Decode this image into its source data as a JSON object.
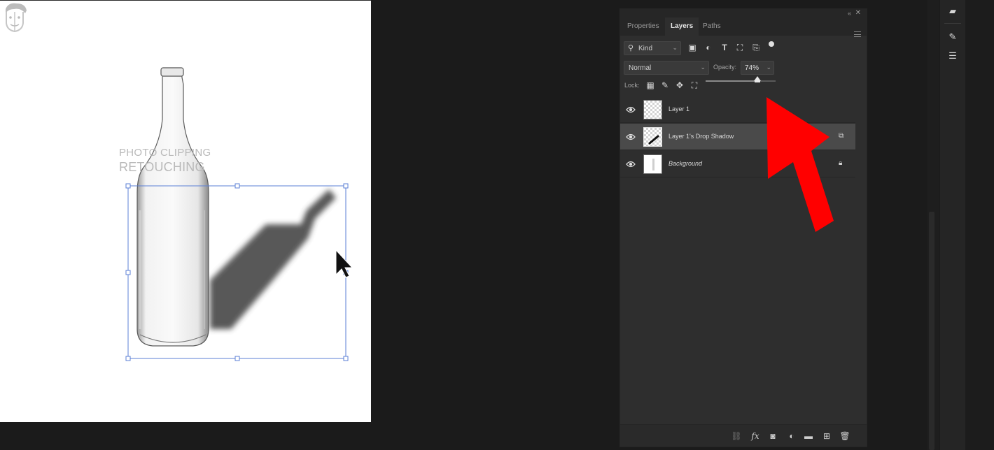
{
  "canvas": {
    "watermark": {
      "line1": "PHOTO CLIPPING",
      "line2": "RETOUCHING"
    }
  },
  "panel": {
    "tabs": [
      {
        "label": "Properties",
        "active": false
      },
      {
        "label": "Layers",
        "active": true
      },
      {
        "label": "Paths",
        "active": false
      }
    ],
    "filter": {
      "kind_label": "Kind"
    },
    "blend_mode": "Normal",
    "opacity": {
      "label": "Opacity:",
      "value": "74%",
      "level": 0.74
    },
    "lock_label": "Lock:",
    "layers": [
      {
        "name": "Layer 1",
        "selected": false,
        "visible": true,
        "italic": false,
        "badge": ""
      },
      {
        "name": "Layer 1's Drop Shadow",
        "selected": true,
        "visible": true,
        "italic": false,
        "badge": "linked-layer-icon"
      },
      {
        "name": "Background",
        "selected": false,
        "visible": true,
        "italic": true,
        "badge": "lock-icon"
      }
    ],
    "bottom_icons": [
      "link-layers-icon",
      "fx-icon",
      "add-mask-icon",
      "adjustment-layer-icon",
      "group-folder-icon",
      "new-layer-icon",
      "delete-layer-icon"
    ]
  },
  "right_toolbar": {
    "icons": [
      "comment-icon",
      "brush-settings-icon",
      "adjustments-sliders-icon"
    ]
  },
  "colors": {
    "arrow": "#ff0000",
    "selection": "#4a6fd8",
    "panel_bg": "#2e2e2e"
  }
}
